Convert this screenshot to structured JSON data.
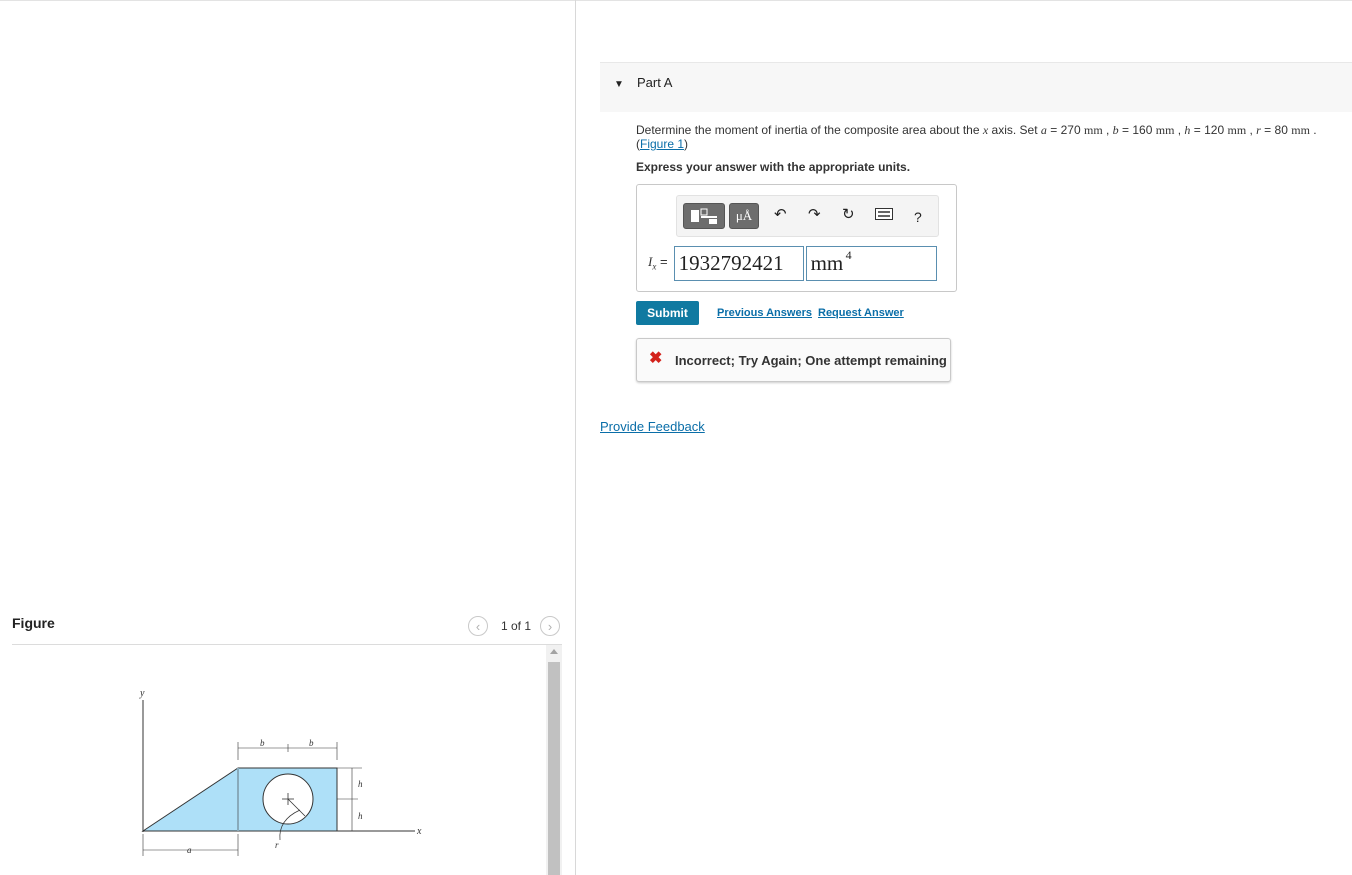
{
  "figure": {
    "title": "Figure",
    "pagination": "1 of 1",
    "diagram_labels": {
      "y_axis": "y",
      "x_axis": "x",
      "b_left": "b",
      "b_right": "b",
      "h_top": "h",
      "h_bottom": "h",
      "a": "a",
      "r": "r"
    },
    "colors": {
      "shape_fill": "#aee0f8"
    }
  },
  "part": {
    "title": "Part A",
    "problem_text": "Determine the moment of inertia of the composite area about the",
    "axis_var": "x",
    "axis_word": "axis. Set",
    "vars": {
      "a_sym": "a",
      "a_val": "270",
      "b_sym": "b",
      "b_val": "160",
      "h_sym": "h",
      "h_val": "120",
      "r_sym": "r",
      "r_val": "80",
      "unit": "mm"
    },
    "figure_link": "Figure 1",
    "instruction": "Express your answer with the appropriate units."
  },
  "answer": {
    "label_sym": "I",
    "label_sub": "x",
    "label_eq": "=",
    "value": "1932792421",
    "unit": "mm",
    "unit_exponent": "4",
    "toolbar_help": "?"
  },
  "actions": {
    "submit": "Submit",
    "previous_answers": "Previous Answers",
    "request_answer": "Request Answer",
    "provide_feedback": "Provide Feedback"
  },
  "feedback": {
    "icon": "✖",
    "message": "Incorrect; Try Again; One attempt remaining"
  },
  "colors": {
    "accent": "#107aa1",
    "link": "#0a6ea8",
    "error": "#d3211a"
  }
}
